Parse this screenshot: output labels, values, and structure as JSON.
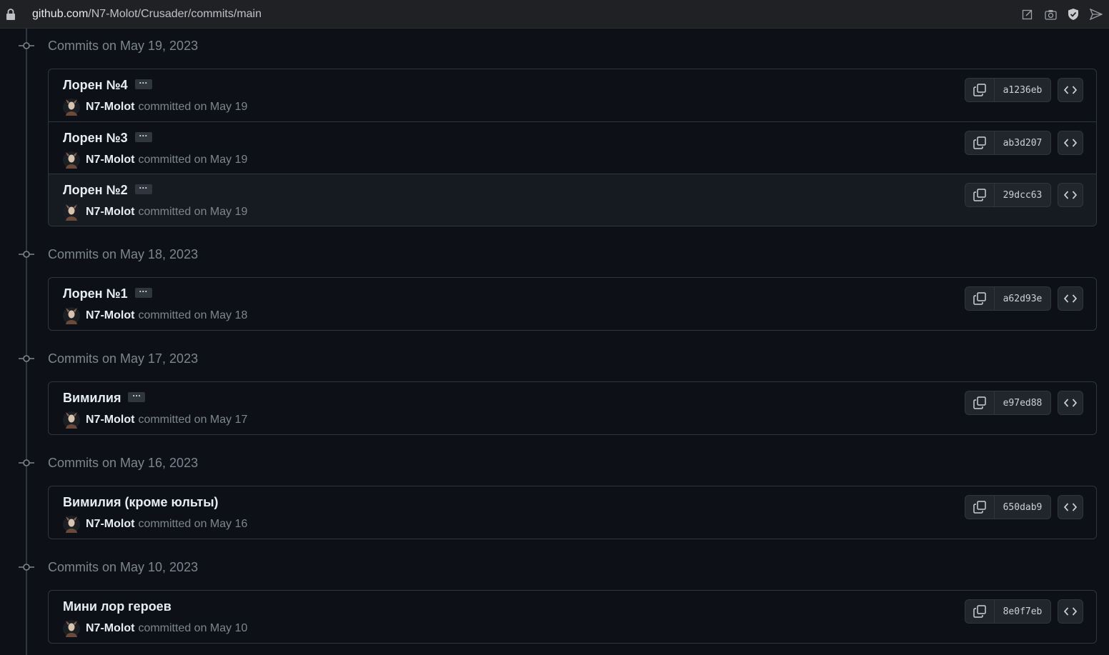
{
  "browser": {
    "url_host": "github.com",
    "url_path": "/N7-Molot/Crusader/commits/main",
    "icons": [
      "edit-page-icon",
      "screenshot-icon",
      "shield-icon",
      "send-icon"
    ]
  },
  "colors": {
    "background": "#0d1117",
    "border": "#30363d",
    "muted_text": "#7d8590",
    "button_bg": "#21262d"
  },
  "groups": [
    {
      "header": "Commits on May 19, 2023",
      "commits": [
        {
          "title": "Лорен №4",
          "ellipsis": "···",
          "author": "N7-Molot",
          "committed": "committed on May 19",
          "sha": "a1236eb"
        },
        {
          "title": "Лорен №3",
          "ellipsis": "···",
          "author": "N7-Molot",
          "committed": "committed on May 19",
          "sha": "ab3d207"
        },
        {
          "title": "Лорен №2",
          "ellipsis": "···",
          "author": "N7-Molot",
          "committed": "committed on May 19",
          "sha": "29dcc63"
        }
      ]
    },
    {
      "header": "Commits on May 18, 2023",
      "commits": [
        {
          "title": "Лорен №1",
          "ellipsis": "···",
          "author": "N7-Molot",
          "committed": "committed on May 18",
          "sha": "a62d93e"
        }
      ]
    },
    {
      "header": "Commits on May 17, 2023",
      "commits": [
        {
          "title": "Вимилия",
          "ellipsis": "···",
          "author": "N7-Molot",
          "committed": "committed on May 17",
          "sha": "e97ed88"
        }
      ]
    },
    {
      "header": "Commits on May 16, 2023",
      "commits": [
        {
          "title": "Вимилия (кроме юльты)",
          "author": "N7-Molot",
          "committed": "committed on May 16",
          "sha": "650dab9"
        }
      ]
    },
    {
      "header": "Commits on May 10, 2023",
      "commits": [
        {
          "title": "Мини лор героев",
          "author": "N7-Molot",
          "committed": "committed on May 10",
          "sha": "8e0f7eb"
        }
      ]
    }
  ]
}
